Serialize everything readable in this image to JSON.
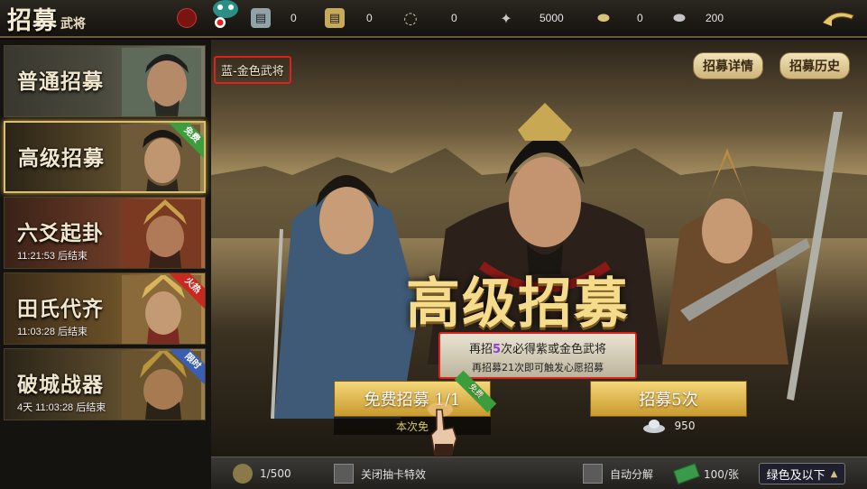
{
  "header": {
    "title_main": "招募",
    "title_sub": "武将",
    "resources": [
      {
        "icon": "scroll-icon",
        "value": "0"
      },
      {
        "icon": "golden-scroll-icon",
        "value": "0"
      },
      {
        "icon": "jade-ring-icon",
        "value": "0"
      },
      {
        "icon": "token-icon",
        "value": "5000"
      },
      {
        "icon": "gold-ingot-icon",
        "value": "0"
      },
      {
        "icon": "silver-ingot-icon",
        "value": "200"
      }
    ]
  },
  "sidebar": {
    "tabs": [
      {
        "label": "普通招募",
        "timer": "",
        "badge": ""
      },
      {
        "label": "高级招募",
        "timer": "",
        "badge": "免费"
      },
      {
        "label": "六爻起卦",
        "timer": "11:21:53 后结束",
        "badge": ""
      },
      {
        "label": "田氏代齐",
        "timer": "11:03:28 后结束",
        "badge": "火热"
      },
      {
        "label": "破城战器",
        "timer": "4天 11:03:28 后结束",
        "badge": "限时"
      }
    ]
  },
  "main": {
    "rarity_label": "蓝-金色武将",
    "detail_button": "招募详情",
    "history_button": "招募历史",
    "banner_title": "高级招募",
    "hint_pre": "再招",
    "hint_count": "5",
    "hint_post": "次必得紫或金色武将",
    "hint_line2": "再招募21次即可触发心愿招募",
    "free_button": "免费招募 1/1",
    "free_badge": "免费",
    "free_sub": "本次免",
    "multi_button": "招募5次",
    "multi_cost": "950"
  },
  "bottom": {
    "count": "1/500",
    "disable_effect_label": "关闭抽卡特效",
    "auto_decompose_label": "自动分解",
    "ticket_count": "100/张",
    "filter_value": "绿色及以下"
  },
  "colors": {
    "highlight_red": "#e0201a",
    "gold": "#d9bf6e",
    "purple_number": "#8b3fd6"
  }
}
